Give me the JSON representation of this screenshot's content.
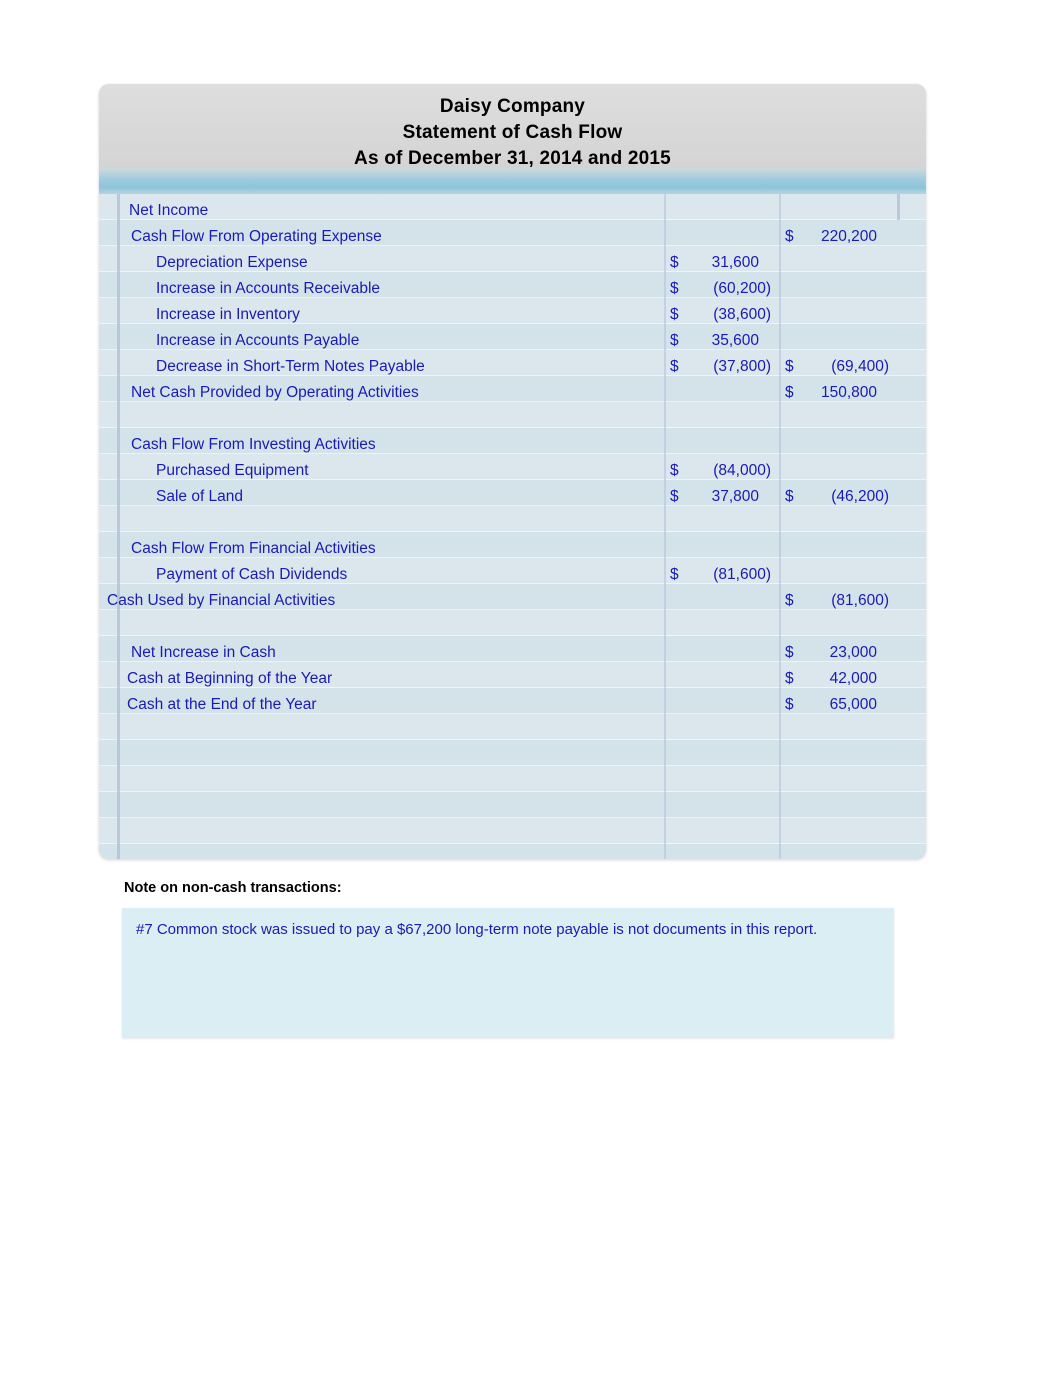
{
  "report": {
    "company": "Daisy Company",
    "statement": "Statement of Cash Flow",
    "period": "As of December 31, 2014 and 2015"
  },
  "rows": [
    {
      "label": "Net Income",
      "indent": "i0",
      "col1_cur": "",
      "col1": "",
      "col2_cur": "",
      "col2": ""
    },
    {
      "label": "Cash Flow From Operating Expense",
      "indent": "i1",
      "col1_cur": "",
      "col1": "",
      "col2_cur": "$",
      "col2": "220,200",
      "col2_pos": true
    },
    {
      "label": "Depreciation Expense",
      "indent": "i2",
      "col1_cur": "$",
      "col1": "31,600",
      "col1_pos": true,
      "col2_cur": "",
      "col2": ""
    },
    {
      "label": "Increase in Accounts Receivable",
      "indent": "i2",
      "col1_cur": "$",
      "col1": "(60,200)",
      "col2_cur": "",
      "col2": ""
    },
    {
      "label": "Increase in Inventory",
      "indent": "i2",
      "col1_cur": "$",
      "col1": "(38,600)",
      "col2_cur": "",
      "col2": ""
    },
    {
      "label": "Increase in Accounts Payable",
      "indent": "i2",
      "col1_cur": "$",
      "col1": "35,600",
      "col1_pos": true,
      "col2_cur": "",
      "col2": ""
    },
    {
      "label": "Decrease in Short-Term Notes Payable",
      "indent": "i2",
      "col1_cur": "$",
      "col1": "(37,800)",
      "col2_cur": "$",
      "col2": "(69,400)"
    },
    {
      "label": "Net Cash Provided by Operating Activities",
      "indent": "i1",
      "col1_cur": "",
      "col1": "",
      "col2_cur": "$",
      "col2": "150,800",
      "col2_pos": true
    },
    {
      "label": "",
      "indent": "i0",
      "col1_cur": "",
      "col1": "",
      "col2_cur": "",
      "col2": ""
    },
    {
      "label": "Cash Flow From Investing Activities",
      "indent": "i1",
      "col1_cur": "",
      "col1": "",
      "col2_cur": "",
      "col2": ""
    },
    {
      "label": "Purchased Equipment",
      "indent": "i2",
      "col1_cur": "$",
      "col1": "(84,000)",
      "col2_cur": "",
      "col2": ""
    },
    {
      "label": "Sale of Land",
      "indent": "i2",
      "col1_cur": "$",
      "col1": "37,800",
      "col1_pos": true,
      "col2_cur": "$",
      "col2": "(46,200)"
    },
    {
      "label": "",
      "indent": "i0",
      "col1_cur": "",
      "col1": "",
      "col2_cur": "",
      "col2": ""
    },
    {
      "label": "Cash Flow From Financial Activities",
      "indent": "i1",
      "col1_cur": "",
      "col1": "",
      "col2_cur": "",
      "col2": ""
    },
    {
      "label": "Payment of Cash Dividends",
      "indent": "i2",
      "col1_cur": "$",
      "col1": "(81,600)",
      "col2_cur": "",
      "col2": ""
    },
    {
      "label": "Cash Used by Financial Activities",
      "indent": "i00",
      "col1_cur": "",
      "col1": "",
      "col2_cur": "$",
      "col2": "(81,600)"
    },
    {
      "label": "",
      "indent": "i0",
      "col1_cur": "",
      "col1": "",
      "col2_cur": "",
      "col2": ""
    },
    {
      "label": "Net Increase in Cash",
      "indent": "i1",
      "col1_cur": "",
      "col1": "",
      "col2_cur": "$",
      "col2": "23,000",
      "col2_pos": true
    },
    {
      "label": "Cash at Beginning of the Year",
      "indent": "i0",
      "col1_cur": "",
      "col1": "",
      "col2_cur": "$",
      "col2": "42,000",
      "col2_pos": true
    },
    {
      "label": "Cash at the End of the Year",
      "indent": "i0",
      "col1_cur": "",
      "col1": "",
      "col2_cur": "$",
      "col2": "65,000",
      "col2_pos": true
    }
  ],
  "note": {
    "title": "Note on non-cash transactions:",
    "text": "#7 Common stock was issued to pay a $67,200 long-term note payable is not documents in this report."
  },
  "colors": {
    "text_blue": "#1a1ab4",
    "panel_header": "#d8d8d8",
    "band_teal": "#8cc4da",
    "grid_bg": "#d4e3ea",
    "note_bg": "#daeef3"
  }
}
